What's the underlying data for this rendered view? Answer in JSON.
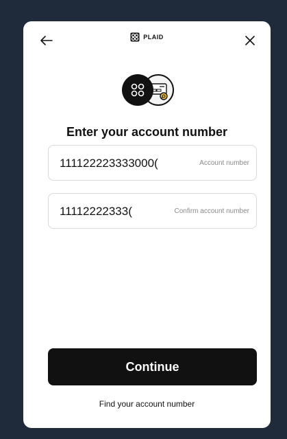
{
  "header": {
    "brand": "PLAID",
    "back_icon": "arrow-left-icon",
    "close_icon": "close-icon"
  },
  "hero": {
    "left_icon": "plaid-logo-icon",
    "right_icon": "bank-check-search-icon"
  },
  "form": {
    "title": "Enter your account number",
    "account_number": {
      "value": "111122223333000(",
      "label": "Account number"
    },
    "confirm_account_number": {
      "value": "11112222333(",
      "label": "Confirm account number"
    }
  },
  "actions": {
    "continue_label": "Continue",
    "find_link": "Find your account number"
  },
  "colors": {
    "background": "#1f2a3a",
    "card": "#ffffff",
    "primary": "#111111",
    "accent": "#f2c230"
  }
}
